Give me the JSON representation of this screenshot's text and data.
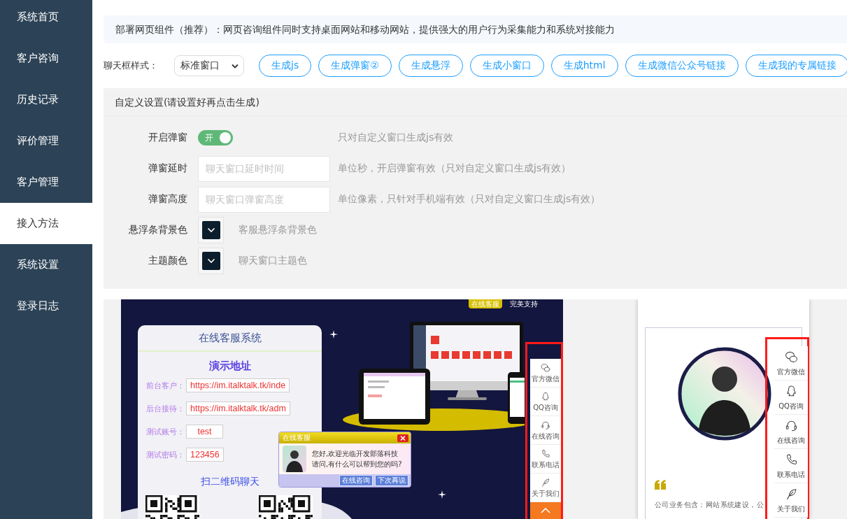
{
  "sidebar": {
    "items": [
      {
        "label": "系统首页",
        "selected": false
      },
      {
        "label": "客户咨询",
        "selected": false
      },
      {
        "label": "历史记录",
        "selected": false
      },
      {
        "label": "评价管理",
        "selected": false
      },
      {
        "label": "客户管理",
        "selected": false
      },
      {
        "label": "接入方法",
        "selected": true
      },
      {
        "label": "系统设置",
        "selected": false
      },
      {
        "label": "登录日志",
        "selected": false
      }
    ]
  },
  "notice": "部署网页组件（推荐）：网页咨询组件同时支持桌面网站和移动网站，提供强大的用户行为采集能力和系统对接能力",
  "style_row": {
    "label": "聊天框样式：",
    "select_value": "标准窗口",
    "buttons": [
      "生成js",
      "生成弹窗②",
      "生成悬浮",
      "生成小窗口",
      "生成html",
      "生成微信公众号链接",
      "生成我的专属链接"
    ]
  },
  "settings": {
    "title": "自定义设置(请设置好再点击生成)",
    "rows": [
      {
        "kind": "switch",
        "label": "开启弹窗",
        "on": true,
        "switch_text": "开",
        "hint": "只对自定义窗口生成js有效"
      },
      {
        "kind": "input",
        "label": "弹窗延时",
        "placeholder": "聊天窗口延时时间",
        "hint": "单位秒，开启弹窗有效（只对自定义窗口生成js有效）"
      },
      {
        "kind": "input",
        "label": "弹窗高度",
        "placeholder": "聊天窗口弹窗高度",
        "hint": "单位像素，只针对手机端有效（只对自定义窗口生成js有效）"
      },
      {
        "kind": "color",
        "label": "悬浮条背景色",
        "color": "#0c1e2c",
        "hint": "客服悬浮条背景色"
      },
      {
        "kind": "color",
        "label": "主题颜色",
        "color": "#0c1e2c",
        "hint": "聊天窗口主题色"
      }
    ]
  },
  "preview": {
    "desktop": {
      "badge": "在线客服",
      "tagline": "完美支持",
      "card": {
        "title": "在线客服系统",
        "subtitle": "演示地址",
        "fields": [
          {
            "label": "前台客户：",
            "value": "https://im.italktalk.tk/inde"
          },
          {
            "label": "后台接待：",
            "value": "https://im.italktalk.tk/adm"
          },
          {
            "label": "测试账号：",
            "value": "test"
          },
          {
            "label": "测试密码：",
            "value": "123456"
          }
        ],
        "qr_title": "扫二维码聊天"
      },
      "chat_popup": {
        "title": "在线客服",
        "lines": [
          "您好,欢迎光临开发部落科技",
          "请问,有什么可以帮到您的吗?"
        ],
        "buttons": [
          "在线咨询",
          "下次再说"
        ]
      },
      "float_bar": [
        "官方微信",
        "QQ咨询",
        "在线咨询",
        "联系电话",
        "关于我们"
      ]
    },
    "mobile": {
      "intro": "公司业务包含：网站系统建设，公",
      "float_bar": [
        "官方微信",
        "QQ咨询",
        "在线咨询",
        "联系电话",
        "关于我们"
      ]
    }
  }
}
